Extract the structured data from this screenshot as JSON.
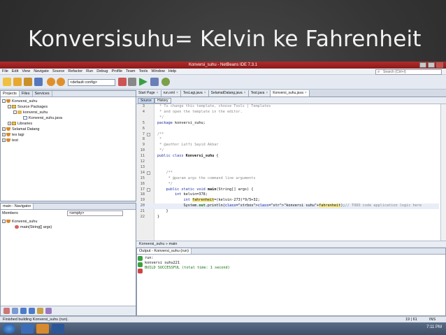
{
  "slide": {
    "title": "Konversisuhu= Kelvin ke Fahrenheit"
  },
  "window": {
    "title": "Konversi_suhu - NetBeans IDE 7.3.1"
  },
  "menu": [
    "File",
    "Edit",
    "View",
    "Navigate",
    "Source",
    "Refactor",
    "Run",
    "Debug",
    "Profile",
    "Team",
    "Tools",
    "Window",
    "Help"
  ],
  "search": {
    "placeholder": "Search (Ctrl+I)"
  },
  "toolbar": {
    "config": "<default config>"
  },
  "projects_panel": {
    "tabs": [
      "Projects",
      "Files",
      "Services"
    ],
    "tree": [
      {
        "label": "Konversi_suhu"
      },
      {
        "label": "Source Packages"
      },
      {
        "label": "konversi_suhu"
      },
      {
        "label": "Konversi_suhu.java"
      },
      {
        "label": "Libraries"
      },
      {
        "label": "Selamat Datang"
      },
      {
        "label": "tes lagi"
      },
      {
        "label": "test"
      }
    ]
  },
  "navigator": {
    "title": "main - Navigator",
    "members_label": "Members",
    "filter": "<empty>",
    "tree": [
      {
        "label": "Konversi_suhu"
      },
      {
        "label": "main(String[] args)"
      }
    ]
  },
  "editor": {
    "tabs": [
      "Start Page",
      "run.xml",
      "TesLagi.java",
      "SelamatDatang.java",
      "Test.java",
      "Konversi_suhu.java"
    ],
    "source_btn": "Source",
    "history_btn": "History",
    "lines": [
      {
        "n": "3",
        "text": " * To change this template, choose Tools | Templates"
      },
      {
        "n": "4",
        "text": " * and open the template in the editor."
      },
      {
        "n": "",
        "text": " */"
      },
      {
        "n": "5",
        "text": "package konversi_suhu;"
      },
      {
        "n": "6",
        "text": ""
      },
      {
        "n": "7",
        "text": "/**"
      },
      {
        "n": "8",
        "text": " *"
      },
      {
        "n": "9",
        "text": " * @author Lutfi Sayid Akbar"
      },
      {
        "n": "10",
        "text": " */"
      },
      {
        "n": "11",
        "text": "public class Konversi_suhu {"
      },
      {
        "n": "12",
        "text": ""
      },
      {
        "n": "13",
        "text": ""
      },
      {
        "n": "14",
        "text": "    /**"
      },
      {
        "n": "15",
        "text": "     * @param args the command line arguments"
      },
      {
        "n": "16",
        "text": "     */"
      },
      {
        "n": "17",
        "text": "    public static void main(String[] args) {"
      },
      {
        "n": "18",
        "text": "        int kelvin=378;"
      },
      {
        "n": "19",
        "text": "            int fahrenheit=(kelvin-273)*9/5+32;"
      },
      {
        "n": "20",
        "text": "            System.out.println(\"konversi suhu\"+fahrenheit);// TODO code application logic here"
      },
      {
        "n": "21",
        "text": "    }"
      },
      {
        "n": "22",
        "text": "}"
      }
    ]
  },
  "breadcrumb": {
    "items": [
      "Konversi_suhu",
      "main"
    ]
  },
  "output": {
    "title": "Output - Konversi_suhu (run)",
    "lines": [
      "run:",
      "konversi suhu221",
      "BUILD SUCCESSFUL (total time: 1 second)"
    ]
  },
  "status": {
    "left": "Finished building Konversi_suhu (run).",
    "position": "19 | 61",
    "mode": "INS"
  },
  "taskbar": {
    "clock": "7:11 PM"
  },
  "colors": {
    "title_bar": "#a52222",
    "taskbar": "#4a5b74",
    "slide_text": "#f2f2f2"
  }
}
